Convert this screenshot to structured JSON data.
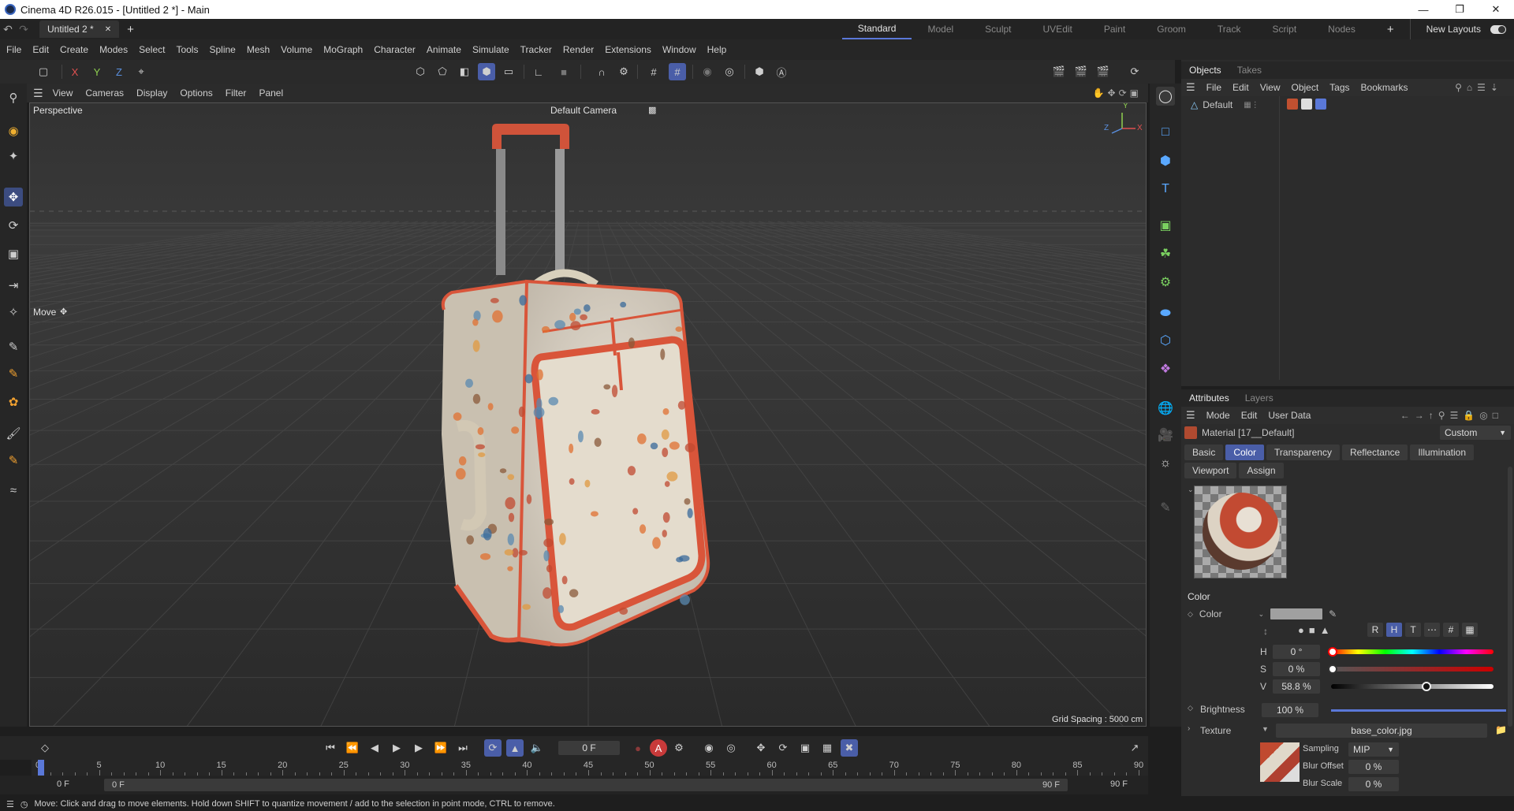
{
  "window": {
    "title": "Cinema 4D R26.015 - [Untitled 2 *] - Main",
    "controls": [
      "—",
      "❐",
      "✕"
    ]
  },
  "tabs": {
    "document": "Untitled 2 *",
    "close": "✕",
    "add": "+"
  },
  "layouts": {
    "items": [
      "Standard",
      "Model",
      "Sculpt",
      "UVEdit",
      "Paint",
      "Groom",
      "Track",
      "Script",
      "Nodes"
    ],
    "add": "+",
    "new_layouts": "New Layouts"
  },
  "menu": [
    "File",
    "Edit",
    "Create",
    "Modes",
    "Select",
    "Tools",
    "Spline",
    "Mesh",
    "Volume",
    "MoGraph",
    "Character",
    "Animate",
    "Simulate",
    "Tracker",
    "Render",
    "Extensions",
    "Window",
    "Help"
  ],
  "toolbar": {
    "axis_x": "X",
    "axis_y": "Y",
    "axis_z": "Z"
  },
  "viewport": {
    "menu": [
      "View",
      "Cameras",
      "Display",
      "Options",
      "Filter",
      "Panel"
    ],
    "projection": "Perspective",
    "camera": "Default Camera",
    "tool_label": "Move",
    "grid_spacing": "Grid Spacing : 5000 cm",
    "axis_y": "Y",
    "axis_x": "X",
    "axis_z": "Z"
  },
  "objects_panel": {
    "tabs": [
      "Objects",
      "Takes"
    ],
    "menu": [
      "File",
      "Edit",
      "View",
      "Object",
      "Tags",
      "Bookmarks"
    ],
    "object_name": "Default"
  },
  "attributes": {
    "tabs": [
      "Attributes",
      "Layers"
    ],
    "menu": [
      "Mode",
      "Edit",
      "User Data"
    ],
    "material_name": "Material [17__Default]",
    "preset": "Custom",
    "channel_tabs": [
      "Basic",
      "Color",
      "Transparency",
      "Reflectance",
      "Illumination",
      "Viewport",
      "Assign"
    ],
    "active_tab": "Color",
    "section": "Color",
    "color_label": "Color",
    "color_swatch": "#a0a0a0",
    "modes": [
      "R",
      "H",
      "T"
    ],
    "h_label": "H",
    "h_value": "0 °",
    "s_label": "S",
    "s_value": "0 %",
    "v_label": "V",
    "v_value": "58.8 %",
    "v_level": 0.588,
    "brightness_label": "Brightness",
    "brightness_value": "100 %",
    "brightness_level": 1.0,
    "texture_label": "Texture",
    "texture_file": "base_color.jpg",
    "sampling_label": "Sampling",
    "sampling_value": "MIP",
    "blur_offset_label": "Blur Offset",
    "blur_offset_value": "0 %",
    "blur_scale_label": "Blur Scale",
    "blur_scale_value": "0 %"
  },
  "timeline": {
    "current_frame": "0 F",
    "ticks": [
      "0",
      "5",
      "10",
      "15",
      "20",
      "25",
      "30",
      "35",
      "40",
      "45",
      "50",
      "55",
      "60",
      "65",
      "70",
      "75",
      "80",
      "85",
      "90"
    ],
    "start": "0 F",
    "start_preview": "0 F",
    "end_preview": "90 F",
    "end": "90 F"
  },
  "status": {
    "message": "Move: Click and drag to move elements. Hold down SHIFT to quantize movement / add to the selection in point mode, CTRL to remove."
  },
  "colors": {
    "accent": "#4a5ea8",
    "bag_trim": "#d9553a",
    "bag_body": "#e6ded0"
  }
}
